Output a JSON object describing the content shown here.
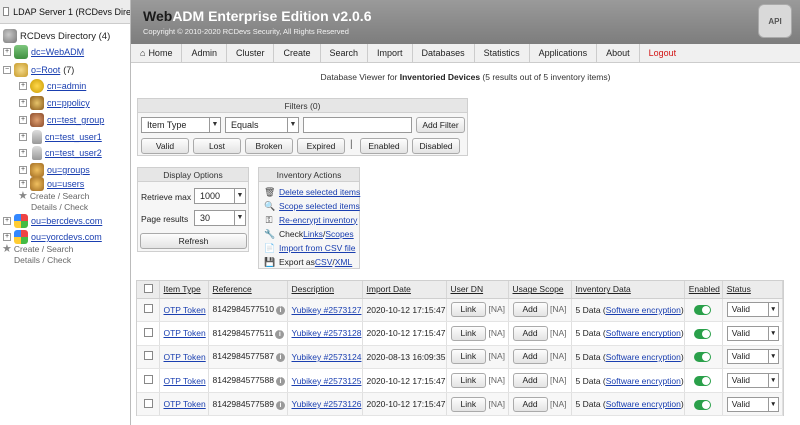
{
  "server_tab": {
    "label": "LDAP Server 1 (RCDevs Dire"
  },
  "tree": {
    "root_label": "RCDevs Directory (4)",
    "dc_webadm": "dc=WebADM",
    "o_root": "o=Root",
    "o_root_count": "(7)",
    "children": [
      "cn=admin",
      "cn=ppolicy",
      "cn=test_group",
      "cn=test_user1",
      "cn=test_user2",
      "ou=groups",
      "ou=users"
    ],
    "ghost1_line1": "Create / Search",
    "ghost1_line2": "Details / Check",
    "ou_bercdevs": "ou=bercdevs.com",
    "ou_yorcdevs": "ou=yorcdevs.com",
    "ghost2_line1": "Create / Search",
    "ghost2_line2": "Details / Check"
  },
  "header": {
    "brand_web": "Web",
    "brand_adm": "ADM",
    "brand_rest": " Enterprise Edition v2.0.6",
    "copyright": "Copyright © 2010-2020 RCDevs Security, All Rights Reserved",
    "logo_text": "API"
  },
  "nav": [
    "Home",
    "Admin",
    "Cluster",
    "Create",
    "Search",
    "Import",
    "Databases",
    "Statistics",
    "Applications",
    "About"
  ],
  "nav_logout": "Logout",
  "viewer": {
    "prefix": "Database Viewer for ",
    "name": "Inventoried Devices",
    "suffix": " (5 results out of 5 inventory items)"
  },
  "filters": {
    "title": "Filters (0)",
    "field_select": "Item Type",
    "op_select": "Equals",
    "value": "",
    "add_button": "Add Filter",
    "quick": [
      "Valid",
      "Lost",
      "Broken",
      "Expired"
    ],
    "quick2": [
      "Enabled",
      "Disabled"
    ],
    "separator": "|"
  },
  "display": {
    "title": "Display Options",
    "retrieve_label": "Retrieve max",
    "retrieve_value": "1000",
    "page_label": "Page results",
    "page_value": "30",
    "refresh": "Refresh"
  },
  "actions": {
    "title": "Inventory Actions",
    "delete": "Delete selected items",
    "scope": "Scope selected items",
    "reencrypt": "Re-encrypt inventory",
    "check_prefix": "Check ",
    "check_links": "Links",
    "check_sep": " / ",
    "check_scopes": "Scopes",
    "import": "Import from CSV file",
    "export_prefix": "Export as ",
    "export_csv": "CSV",
    "export_sep": " / ",
    "export_xml": "XML"
  },
  "table": {
    "headers": [
      "Item Type",
      "Reference",
      "Description",
      "Import Date",
      "User DN",
      "Usage Scope",
      "Inventory Data",
      "Enabled",
      "Status"
    ],
    "link_btn": "Link",
    "add_btn": "Add",
    "na": "[NA]",
    "rows": [
      {
        "type": "OTP Token",
        "ref": "8142984577510",
        "desc": "Yubikey #2573127",
        "date": "2020-10-12 17:15:47",
        "data_prefix": "5 Data (",
        "data_link": "Software encryption",
        "data_suffix": ")",
        "status": "Valid"
      },
      {
        "type": "OTP Token",
        "ref": "8142984577511",
        "desc": "Yubikey #2573128",
        "date": "2020-10-12 17:15:47",
        "data_prefix": "5 Data (",
        "data_link": "Software encryption",
        "data_suffix": ")",
        "status": "Valid"
      },
      {
        "type": "OTP Token",
        "ref": "8142984577587",
        "desc": "Yubikey #2573124",
        "date": "2020-08-13 16:09:35",
        "data_prefix": "5 Data (",
        "data_link": "Software encryption",
        "data_suffix": ")",
        "status": "Valid"
      },
      {
        "type": "OTP Token",
        "ref": "8142984577588",
        "desc": "Yubikey #2573125",
        "date": "2020-10-12 17:15:47",
        "data_prefix": "5 Data (",
        "data_link": "Software encryption",
        "data_suffix": ")",
        "status": "Valid"
      },
      {
        "type": "OTP Token",
        "ref": "8142984577589",
        "desc": "Yubikey #2573126",
        "date": "2020-10-12 17:15:47",
        "data_prefix": "5 Data (",
        "data_link": "Software encryption",
        "data_suffix": ")",
        "status": "Valid"
      }
    ]
  },
  "colors": {
    "header": "#8a8a8a",
    "link": "#1a3fb0",
    "logout": "#d21414",
    "toggle_on": "#2aa04a"
  }
}
